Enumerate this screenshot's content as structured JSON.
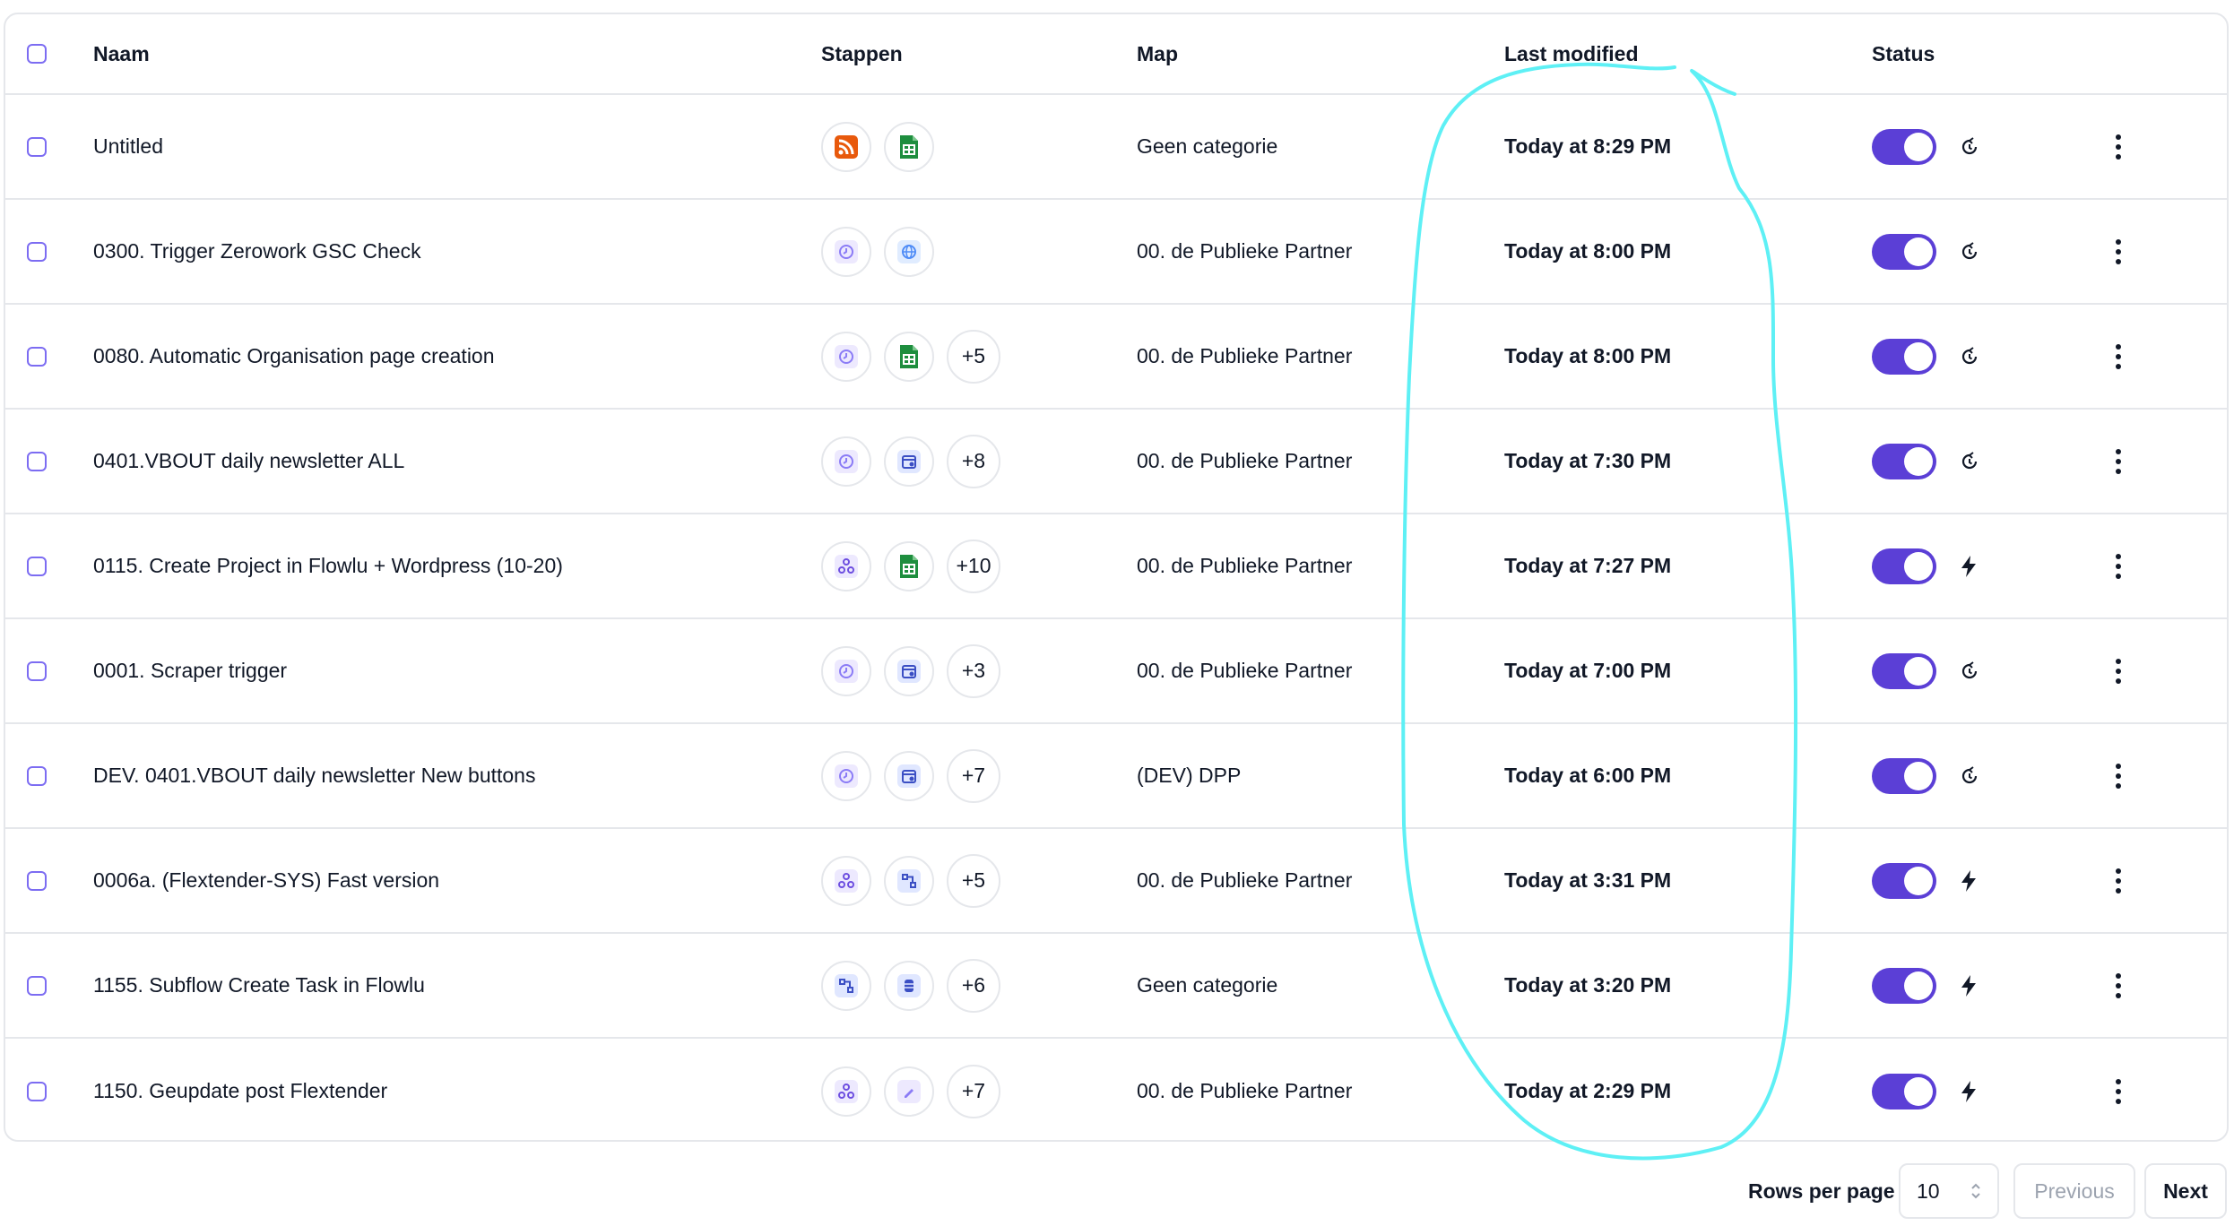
{
  "header": {
    "name": "Naam",
    "steps": "Stappen",
    "map": "Map",
    "modified": "Last modified",
    "status": "Status"
  },
  "rows": [
    {
      "name": "Untitled",
      "steps": [
        "rss-icon",
        "spreadsheet-icon"
      ],
      "extra": "",
      "map": "Geen categorie",
      "modified": "Today at 8:29 PM",
      "trigger": "schedule-icon"
    },
    {
      "name": "0300. Trigger Zerowork GSC Check",
      "steps": [
        "schedule-icon",
        "globe-icon"
      ],
      "extra": "",
      "map": "00. de Publieke Partner",
      "modified": "Today at 8:00 PM",
      "trigger": "schedule-icon"
    },
    {
      "name": "0080. Automatic Organisation page creation",
      "steps": [
        "schedule-icon",
        "spreadsheet-icon"
      ],
      "extra": "+5",
      "map": "00. de Publieke Partner",
      "modified": "Today at 8:00 PM",
      "trigger": "schedule-icon"
    },
    {
      "name": "0401.VBOUT daily newsletter ALL",
      "steps": [
        "schedule-icon",
        "calendar-icon"
      ],
      "extra": "+8",
      "map": "00. de Publieke Partner",
      "modified": "Today at 7:30 PM",
      "trigger": "schedule-icon"
    },
    {
      "name": "0115. Create Project in Flowlu + Wordpress (10-20)",
      "steps": [
        "webhook-icon",
        "spreadsheet-icon"
      ],
      "extra": "+10",
      "map": "00. de Publieke Partner",
      "modified": "Today at 7:27 PM",
      "trigger": "bolt-icon"
    },
    {
      "name": "0001. Scraper trigger",
      "steps": [
        "schedule-icon",
        "calendar-icon"
      ],
      "extra": "+3",
      "map": "00. de Publieke Partner",
      "modified": "Today at 7:00 PM",
      "trigger": "schedule-icon"
    },
    {
      "name": "DEV. 0401.VBOUT daily newsletter New buttons",
      "steps": [
        "schedule-icon",
        "calendar-icon"
      ],
      "extra": "+7",
      "map": "(DEV) DPP",
      "modified": "Today at 6:00 PM",
      "trigger": "schedule-icon"
    },
    {
      "name": "0006a. (Flextender-SYS) Fast version",
      "steps": [
        "webhook-icon",
        "subflow-icon"
      ],
      "extra": "+5",
      "map": "00. de Publieke Partner",
      "modified": "Today at 3:31 PM",
      "trigger": "bolt-icon"
    },
    {
      "name": "1155. Subflow Create Task in Flowlu",
      "steps": [
        "subflow-icon",
        "database-icon"
      ],
      "extra": "+6",
      "map": "Geen categorie",
      "modified": "Today at 3:20 PM",
      "trigger": "bolt-icon"
    },
    {
      "name": "1150. Geupdate post Flextender",
      "steps": [
        "webhook-icon",
        "edit-icon"
      ],
      "extra": "+7",
      "map": "00. de Publieke Partner",
      "modified": "Today at 2:29 PM",
      "trigger": "bolt-icon"
    }
  ],
  "footer": {
    "rows_per_page_label": "Rows per page",
    "rows_per_page_value": "10",
    "previous_label": "Previous",
    "next_label": "Next"
  },
  "colors": {
    "accent": "#5b3fd6",
    "checkbox": "#7c6cf2",
    "annotation": "#5ef0f5",
    "rss": "#e8590c",
    "sheets": "#1e8e3e"
  }
}
